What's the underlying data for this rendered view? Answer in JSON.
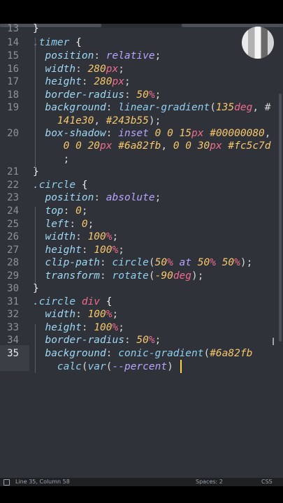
{
  "editor": {
    "lines": [
      {
        "n": "13",
        "parts": [
          {
            "c": "brace",
            "t": "}"
          }
        ]
      },
      {
        "n": "14",
        "parts": [
          {
            "c": "sel",
            "t": ".timer"
          },
          {
            "c": "brace",
            "t": " {"
          }
        ]
      },
      {
        "n": "15",
        "parts": [
          {
            "c": "prop",
            "t": "  position"
          },
          {
            "c": "punct",
            "t": ": "
          },
          {
            "c": "val",
            "t": "relative"
          },
          {
            "c": "punct",
            "t": ";"
          }
        ]
      },
      {
        "n": "16",
        "parts": [
          {
            "c": "prop",
            "t": "  width"
          },
          {
            "c": "punct",
            "t": ": "
          },
          {
            "c": "num",
            "t": "280"
          },
          {
            "c": "unit",
            "t": "px"
          },
          {
            "c": "punct",
            "t": ";"
          }
        ]
      },
      {
        "n": "17",
        "parts": [
          {
            "c": "prop",
            "t": "  height"
          },
          {
            "c": "punct",
            "t": ": "
          },
          {
            "c": "num",
            "t": "280"
          },
          {
            "c": "unit",
            "t": "px"
          },
          {
            "c": "punct",
            "t": ";"
          }
        ]
      },
      {
        "n": "18",
        "parts": [
          {
            "c": "prop",
            "t": "  border-radius"
          },
          {
            "c": "punct",
            "t": ": "
          },
          {
            "c": "num",
            "t": "50"
          },
          {
            "c": "unit",
            "t": "%"
          },
          {
            "c": "punct",
            "t": ";"
          }
        ]
      },
      {
        "n": "19",
        "parts": [
          {
            "c": "prop",
            "t": "  background"
          },
          {
            "c": "punct",
            "t": ": "
          },
          {
            "c": "fn",
            "t": "linear-gradient"
          },
          {
            "c": "punct",
            "t": "("
          },
          {
            "c": "num",
            "t": "135"
          },
          {
            "c": "unit",
            "t": "deg"
          },
          {
            "c": "punct",
            "t": ", #"
          }
        ],
        "wrap": [
          {
            "c": "hex",
            "t": "    141e30"
          },
          {
            "c": "punct",
            "t": ", "
          },
          {
            "c": "hex",
            "t": "#243b55"
          },
          {
            "c": "punct",
            "t": ");"
          }
        ]
      },
      {
        "n": "20",
        "parts": [
          {
            "c": "prop",
            "t": "  box-shadow"
          },
          {
            "c": "punct",
            "t": ": "
          },
          {
            "c": "val",
            "t": "inset "
          },
          {
            "c": "num",
            "t": "0 0 15"
          },
          {
            "c": "unit",
            "t": "px "
          },
          {
            "c": "hex",
            "t": "#00000080"
          },
          {
            "c": "punct",
            "t": ","
          }
        ],
        "wrap": [
          {
            "c": "num",
            "t": "     0 0 20"
          },
          {
            "c": "unit",
            "t": "px "
          },
          {
            "c": "hex",
            "t": "#6a82fb"
          },
          {
            "c": "punct",
            "t": ", "
          },
          {
            "c": "num",
            "t": "0 0 30"
          },
          {
            "c": "unit",
            "t": "px "
          },
          {
            "c": "hex",
            "t": "#fc5c7d"
          }
        ],
        "wrap2": [
          {
            "c": "punct",
            "t": "     ;"
          }
        ]
      },
      {
        "n": "21",
        "parts": [
          {
            "c": "brace",
            "t": "}"
          }
        ]
      },
      {
        "n": "22",
        "parts": [
          {
            "c": "sel",
            "t": ".circle"
          },
          {
            "c": "brace",
            "t": " {"
          }
        ]
      },
      {
        "n": "23",
        "parts": [
          {
            "c": "prop",
            "t": "  position"
          },
          {
            "c": "punct",
            "t": ": "
          },
          {
            "c": "val",
            "t": "absolute"
          },
          {
            "c": "punct",
            "t": ";"
          }
        ]
      },
      {
        "n": "24",
        "parts": [
          {
            "c": "prop",
            "t": "  top"
          },
          {
            "c": "punct",
            "t": ": "
          },
          {
            "c": "num",
            "t": "0"
          },
          {
            "c": "punct",
            "t": ";"
          }
        ]
      },
      {
        "n": "25",
        "parts": [
          {
            "c": "prop",
            "t": "  left"
          },
          {
            "c": "punct",
            "t": ": "
          },
          {
            "c": "num",
            "t": "0"
          },
          {
            "c": "punct",
            "t": ";"
          }
        ]
      },
      {
        "n": "26",
        "parts": [
          {
            "c": "prop",
            "t": "  width"
          },
          {
            "c": "punct",
            "t": ": "
          },
          {
            "c": "num",
            "t": "100"
          },
          {
            "c": "unit",
            "t": "%"
          },
          {
            "c": "punct",
            "t": ";"
          }
        ]
      },
      {
        "n": "27",
        "parts": [
          {
            "c": "prop",
            "t": "  height"
          },
          {
            "c": "punct",
            "t": ": "
          },
          {
            "c": "num",
            "t": "100"
          },
          {
            "c": "unit",
            "t": "%"
          },
          {
            "c": "punct",
            "t": ";"
          }
        ]
      },
      {
        "n": "28",
        "parts": [
          {
            "c": "prop",
            "t": "  clip-path"
          },
          {
            "c": "punct",
            "t": ": "
          },
          {
            "c": "fn",
            "t": "circle"
          },
          {
            "c": "punct",
            "t": "("
          },
          {
            "c": "num",
            "t": "50"
          },
          {
            "c": "unit",
            "t": "%"
          },
          {
            "c": "val",
            "t": " at "
          },
          {
            "c": "num",
            "t": "50"
          },
          {
            "c": "unit",
            "t": "% "
          },
          {
            "c": "num",
            "t": "50"
          },
          {
            "c": "unit",
            "t": "%"
          },
          {
            "c": "punct",
            "t": ");"
          }
        ]
      },
      {
        "n": "29",
        "parts": [
          {
            "c": "prop",
            "t": "  transform"
          },
          {
            "c": "punct",
            "t": ": "
          },
          {
            "c": "fn",
            "t": "rotate"
          },
          {
            "c": "punct",
            "t": "("
          },
          {
            "c": "num",
            "t": "-90"
          },
          {
            "c": "unit",
            "t": "deg"
          },
          {
            "c": "punct",
            "t": ");"
          }
        ]
      },
      {
        "n": "30",
        "parts": [
          {
            "c": "brace",
            "t": "}"
          }
        ]
      },
      {
        "n": "31",
        "parts": [
          {
            "c": "sel",
            "t": ".circle "
          },
          {
            "c": "unit",
            "t": "div"
          },
          {
            "c": "brace",
            "t": " {"
          }
        ]
      },
      {
        "n": "32",
        "parts": [
          {
            "c": "prop",
            "t": "  width"
          },
          {
            "c": "punct",
            "t": ": "
          },
          {
            "c": "num",
            "t": "100"
          },
          {
            "c": "unit",
            "t": "%"
          },
          {
            "c": "punct",
            "t": ";"
          }
        ]
      },
      {
        "n": "33",
        "parts": [
          {
            "c": "prop",
            "t": "  height"
          },
          {
            "c": "punct",
            "t": ": "
          },
          {
            "c": "num",
            "t": "100"
          },
          {
            "c": "unit",
            "t": "%"
          },
          {
            "c": "punct",
            "t": ";"
          }
        ]
      },
      {
        "n": "34",
        "parts": [
          {
            "c": "prop",
            "t": "  border-radius"
          },
          {
            "c": "punct",
            "t": ": "
          },
          {
            "c": "num",
            "t": "50"
          },
          {
            "c": "unit",
            "t": "%"
          },
          {
            "c": "punct",
            "t": ";"
          }
        ]
      },
      {
        "n": "35",
        "active": true,
        "parts": [
          {
            "c": "prop",
            "t": "  background"
          },
          {
            "c": "punct",
            "t": ": "
          },
          {
            "c": "fn",
            "t": "conic-gradient"
          },
          {
            "c": "punct",
            "t": "("
          },
          {
            "c": "hex",
            "t": "#6a82fb"
          }
        ],
        "wrap": [
          {
            "c": "fn",
            "t": "    calc"
          },
          {
            "c": "punct",
            "t": "("
          },
          {
            "c": "fn",
            "t": "var"
          },
          {
            "c": "punct",
            "t": "("
          },
          {
            "c": "val",
            "t": "--percent"
          },
          {
            "c": "punct",
            "t": ") "
          }
        ]
      }
    ]
  },
  "status": {
    "position": "Line 35, Column 58",
    "indent": "Spaces: 2",
    "syntax": "CSS"
  },
  "icons": {
    "cursor": "text-cursor",
    "ibeam": "ibeam-mouse-pointer",
    "avatar": "pixelated-avatar"
  }
}
